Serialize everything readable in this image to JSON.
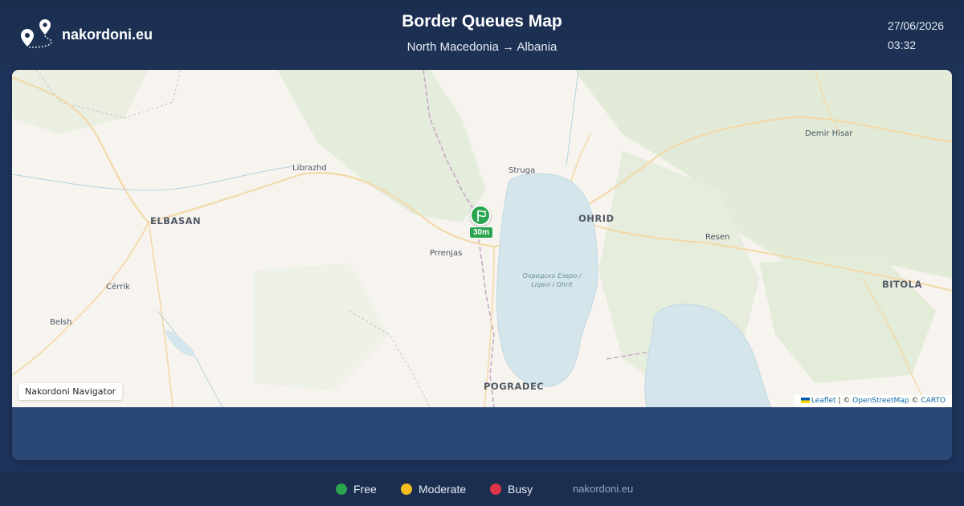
{
  "header": {
    "brand": "nakordoni.eu",
    "title": "Border Queues Map",
    "route": "North Macedonia → Albania",
    "date": "27/06/2026",
    "time": "03:32"
  },
  "map": {
    "places": {
      "elbasan": "ELBASAN",
      "librazhd": "Librazhd",
      "cerrik": "Cërrik",
      "belsh": "Belsh",
      "prrenjas": "Prrenjas",
      "struga": "Struga",
      "ohrid": "OHRID",
      "resen": "Resen",
      "demir_hisar": "Demir Hisar",
      "bitola": "BITOLA",
      "pogradec": "POGRADEC"
    },
    "lake_label_line1": "Охридско Езеро /",
    "lake_label_line2": "Liqeni i Ohrit",
    "marker": {
      "wait": "30m",
      "status": "free",
      "icon": "flag-icon"
    },
    "nav_label": "Nakordoni Navigator",
    "attribution": {
      "leaflet": "Leaflet",
      "sep1": "| ©",
      "osm": "OpenStreetMap",
      "sep2": "©",
      "carto": "CARTO"
    }
  },
  "legend": {
    "items": [
      {
        "label": "Free",
        "color": "#2aa44f"
      },
      {
        "label": "Moderate",
        "color": "#f2bd1d"
      },
      {
        "label": "Busy",
        "color": "#dc3545"
      }
    ],
    "site": "nakordoni.eu"
  },
  "colors": {
    "header_bg": "#1a2d4f",
    "panel_bg": "#2b4775",
    "water": "#d4e5ec",
    "forest": "#dfe9d6"
  }
}
